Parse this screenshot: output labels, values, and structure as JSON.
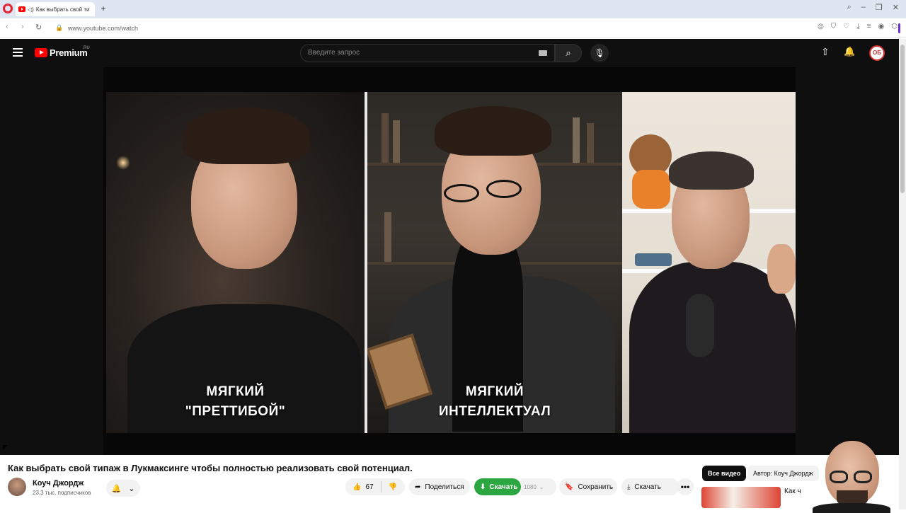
{
  "browser": {
    "tab_title": "Как выбрать свой ти",
    "url": "www.youtube.com/watch"
  },
  "masthead": {
    "logo_text": "Premium",
    "logo_region": "RU",
    "search_placeholder": "Введите запрос",
    "avatar_initials": "ОБ"
  },
  "video": {
    "captions": [
      {
        "line1": "МЯГКИЙ",
        "line2": "\"ПРЕТТИБОЙ\""
      },
      {
        "line1": "МЯГКИЙ",
        "line2": "ИНТЕЛЛЕКТУАЛ"
      }
    ]
  },
  "watch": {
    "title": "Как выбрать свой типаж в Лукмаксинге чтобы полностью реализовать свой потенциал.",
    "channel_name": "Коуч Джордж",
    "subscribers": "23,3 тыс. подписчиков",
    "likes": "67",
    "share_label": "Поделиться",
    "download_green_label": "Скачать",
    "quality": "1080",
    "save_label": "Сохранить",
    "download_label": "Скачать",
    "more_label": "•••"
  },
  "sidebar": {
    "chips": [
      "Все видео",
      "Автор: Коуч Джордж"
    ],
    "rec_title": "Как ч"
  }
}
